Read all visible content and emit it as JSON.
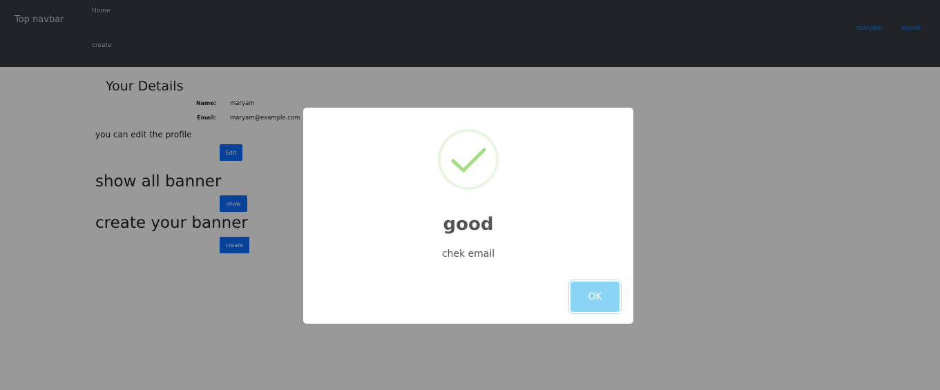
{
  "navbar": {
    "brand": "Top navbar",
    "links": [
      "Home",
      "create"
    ],
    "user": "maryam",
    "logout": "logout"
  },
  "details": {
    "title": "Your Details",
    "name_label": "Name:",
    "name_value": "maryam",
    "email_label": "Email:",
    "email_value": "maryam@example.com",
    "edit_hint": "you can edit the profile",
    "edit_button": "Edit"
  },
  "banners": {
    "show_heading": "show all banner",
    "show_button": "show",
    "create_heading": "create your banner",
    "create_button": "create"
  },
  "modal": {
    "icon": "success-check-icon",
    "title": "good",
    "text": "chek email",
    "ok_button": "OK"
  },
  "colors": {
    "navbar_bg": "#343a40",
    "primary": "#0d6efd",
    "success": "#a5dc86",
    "confirm": "#8cd4f5"
  }
}
